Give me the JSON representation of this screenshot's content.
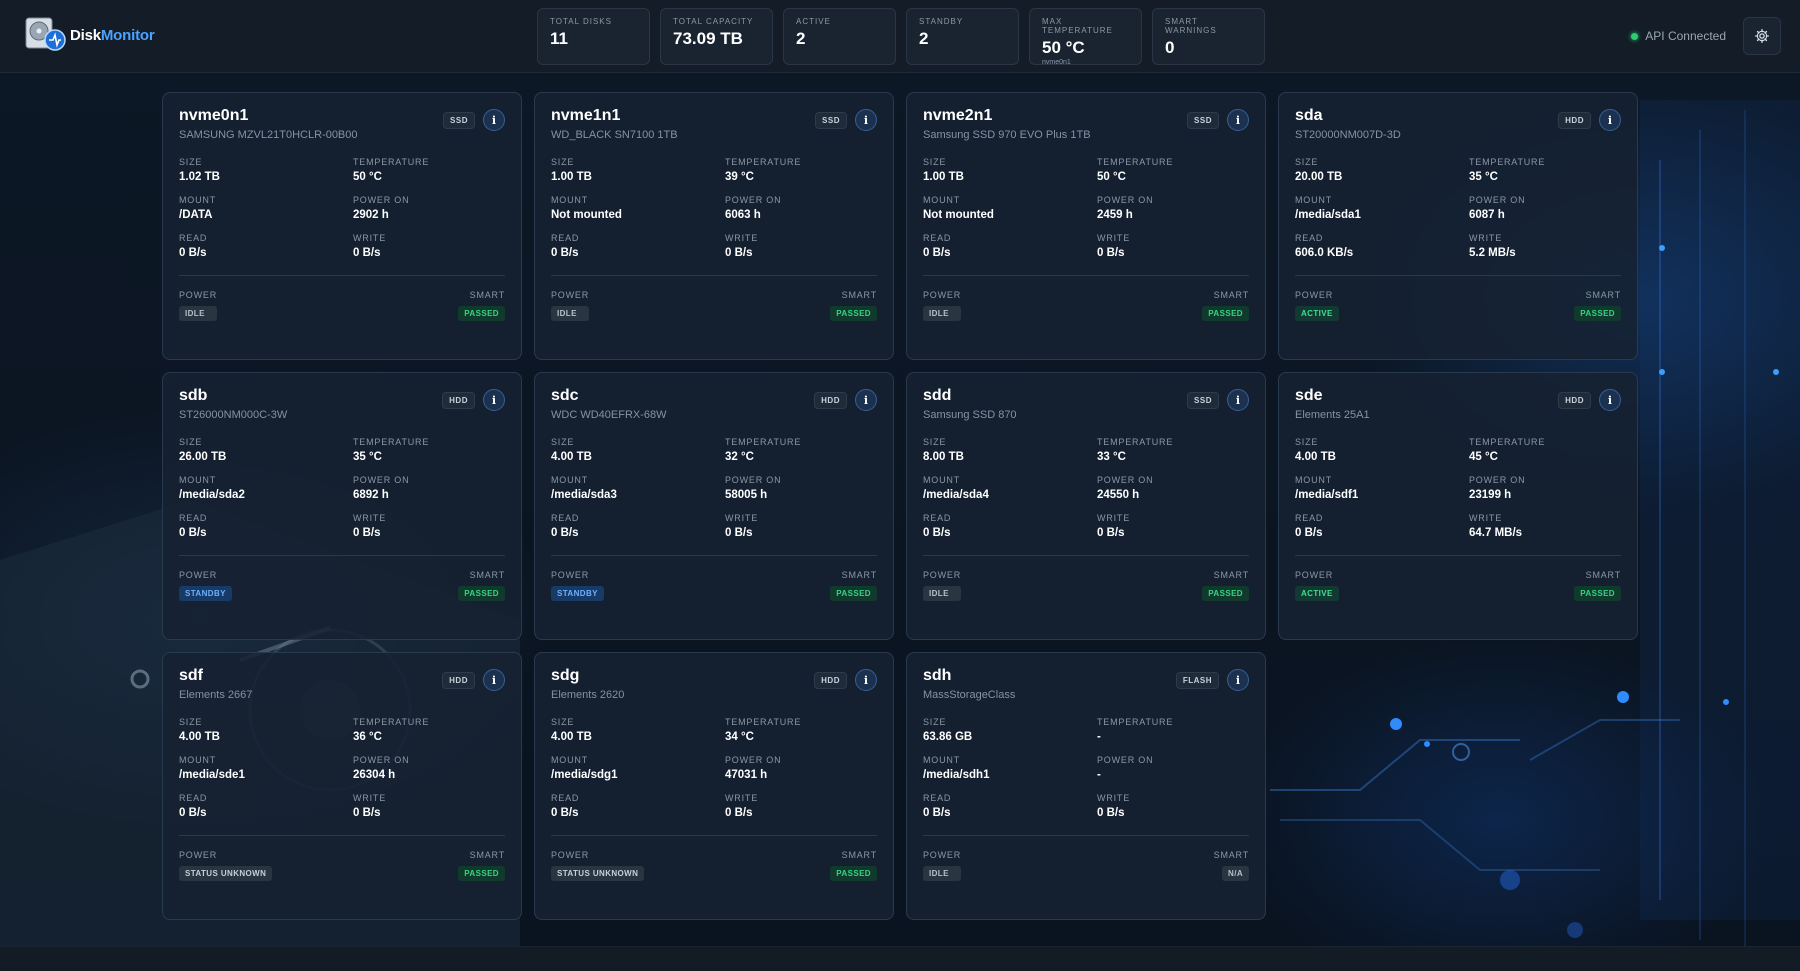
{
  "app": {
    "brand_part1": "Disk",
    "brand_part2": "Monitor"
  },
  "colors": {
    "accent": "#4aa3ff",
    "ok": "#36d486",
    "standby": "#6eb1ff",
    "panel": "#162232"
  },
  "stats": [
    {
      "label": "TOTAL DISKS",
      "value": "11",
      "sub": ""
    },
    {
      "label": "TOTAL CAPACITY",
      "value": "73.09 TB",
      "sub": ""
    },
    {
      "label": "ACTIVE",
      "value": "2",
      "sub": ""
    },
    {
      "label": "STANDBY",
      "value": "2",
      "sub": ""
    },
    {
      "label": "MAX TEMPERATURE",
      "value": "50 °C",
      "sub": "nvme0n1"
    },
    {
      "label": "SMART WARNINGS",
      "value": "0",
      "sub": ""
    }
  ],
  "status": {
    "api_label": "API Connected"
  },
  "labels": {
    "size": "SIZE",
    "temperature": "TEMPERATURE",
    "mount": "MOUNT",
    "power_on": "POWER ON",
    "read": "READ",
    "write": "WRITE",
    "power": "POWER",
    "smart": "SMART",
    "info": "i"
  },
  "disks": [
    {
      "name": "nvme0n1",
      "model": "SAMSUNG MZVL21T0HCLR-00B00",
      "type": "SSD",
      "size": "1.02 TB",
      "temperature": "50 °C",
      "mount": "/DATA",
      "power_on": "2902 h",
      "read": "0 B/s",
      "write": "0 B/s",
      "power": "IDLE",
      "power_kind": "idle",
      "smart": "PASSED",
      "smart_kind": "passed"
    },
    {
      "name": "nvme1n1",
      "model": "WD_BLACK SN7100 1TB",
      "type": "SSD",
      "size": "1.00 TB",
      "temperature": "39 °C",
      "mount": "Not mounted",
      "power_on": "6063 h",
      "read": "0 B/s",
      "write": "0 B/s",
      "power": "IDLE",
      "power_kind": "idle",
      "smart": "PASSED",
      "smart_kind": "passed"
    },
    {
      "name": "nvme2n1",
      "model": "Samsung SSD 970 EVO Plus 1TB",
      "type": "SSD",
      "size": "1.00 TB",
      "temperature": "50 °C",
      "mount": "Not mounted",
      "power_on": "2459 h",
      "read": "0 B/s",
      "write": "0 B/s",
      "power": "IDLE",
      "power_kind": "idle",
      "smart": "PASSED",
      "smart_kind": "passed"
    },
    {
      "name": "sda",
      "model": "ST20000NM007D-3D",
      "type": "HDD",
      "size": "20.00 TB",
      "temperature": "35 °C",
      "mount": "/media/sda1",
      "power_on": "6087 h",
      "read": "606.0 KB/s",
      "write": "5.2 MB/s",
      "power": "ACTIVE",
      "power_kind": "active",
      "smart": "PASSED",
      "smart_kind": "passed"
    },
    {
      "name": "sdb",
      "model": "ST26000NM000C-3W",
      "type": "HDD",
      "size": "26.00 TB",
      "temperature": "35 °C",
      "mount": "/media/sda2",
      "power_on": "6892 h",
      "read": "0 B/s",
      "write": "0 B/s",
      "power": "STANDBY",
      "power_kind": "standby",
      "smart": "PASSED",
      "smart_kind": "passed"
    },
    {
      "name": "sdc",
      "model": "WDC WD40EFRX-68W",
      "type": "HDD",
      "size": "4.00 TB",
      "temperature": "32 °C",
      "mount": "/media/sda3",
      "power_on": "58005 h",
      "read": "0 B/s",
      "write": "0 B/s",
      "power": "STANDBY",
      "power_kind": "standby",
      "smart": "PASSED",
      "smart_kind": "passed"
    },
    {
      "name": "sdd",
      "model": "Samsung SSD 870",
      "type": "SSD",
      "size": "8.00 TB",
      "temperature": "33 °C",
      "mount": "/media/sda4",
      "power_on": "24550 h",
      "read": "0 B/s",
      "write": "0 B/s",
      "power": "IDLE",
      "power_kind": "idle",
      "smart": "PASSED",
      "smart_kind": "passed"
    },
    {
      "name": "sde",
      "model": "Elements 25A1",
      "type": "HDD",
      "size": "4.00 TB",
      "temperature": "45 °C",
      "mount": "/media/sdf1",
      "power_on": "23199 h",
      "read": "0 B/s",
      "write": "64.7 MB/s",
      "power": "ACTIVE",
      "power_kind": "active",
      "smart": "PASSED",
      "smart_kind": "passed"
    },
    {
      "name": "sdf",
      "model": "Elements 2667",
      "type": "HDD",
      "size": "4.00 TB",
      "temperature": "36 °C",
      "mount": "/media/sde1",
      "power_on": "26304 h",
      "read": "0 B/s",
      "write": "0 B/s",
      "power": "STATUS UNKNOWN",
      "power_kind": "unknown",
      "smart": "PASSED",
      "smart_kind": "passed"
    },
    {
      "name": "sdg",
      "model": "Elements 2620",
      "type": "HDD",
      "size": "4.00 TB",
      "temperature": "34 °C",
      "mount": "/media/sdg1",
      "power_on": "47031 h",
      "read": "0 B/s",
      "write": "0 B/s",
      "power": "STATUS UNKNOWN",
      "power_kind": "unknown",
      "smart": "PASSED",
      "smart_kind": "passed"
    },
    {
      "name": "sdh",
      "model": "MassStorageClass",
      "type": "FLASH",
      "size": "63.86 GB",
      "temperature": "-",
      "mount": "/media/sdh1",
      "power_on": "-",
      "read": "0 B/s",
      "write": "0 B/s",
      "power": "IDLE",
      "power_kind": "idle",
      "smart": "N/A",
      "smart_kind": "na"
    }
  ]
}
